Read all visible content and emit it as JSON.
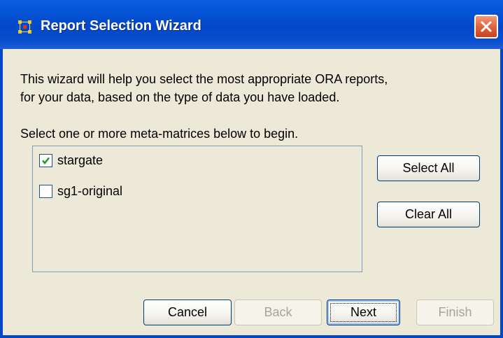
{
  "window": {
    "title": "Report Selection Wizard",
    "icon": "network-grid-icon",
    "close_icon": "close-x-icon"
  },
  "intro": {
    "line1": "This wizard will help you select the most appropriate ORA reports,",
    "line2": "for your data, based on the type of data you have loaded."
  },
  "prompt": "Select one or more meta-matrices below to begin.",
  "meta_matrices": [
    {
      "label": "stargate",
      "checked": true
    },
    {
      "label": "sg1-original",
      "checked": false
    }
  ],
  "side_buttons": {
    "select_all": "Select All",
    "clear_all": "Clear All"
  },
  "footer_buttons": {
    "cancel": "Cancel",
    "back": "Back",
    "next": "Next",
    "finish": "Finish"
  },
  "colors": {
    "titlebar": "#0347c9",
    "close": "#e0653f",
    "dialog_bg": "#ece9d8",
    "checkmark": "#21a121"
  }
}
